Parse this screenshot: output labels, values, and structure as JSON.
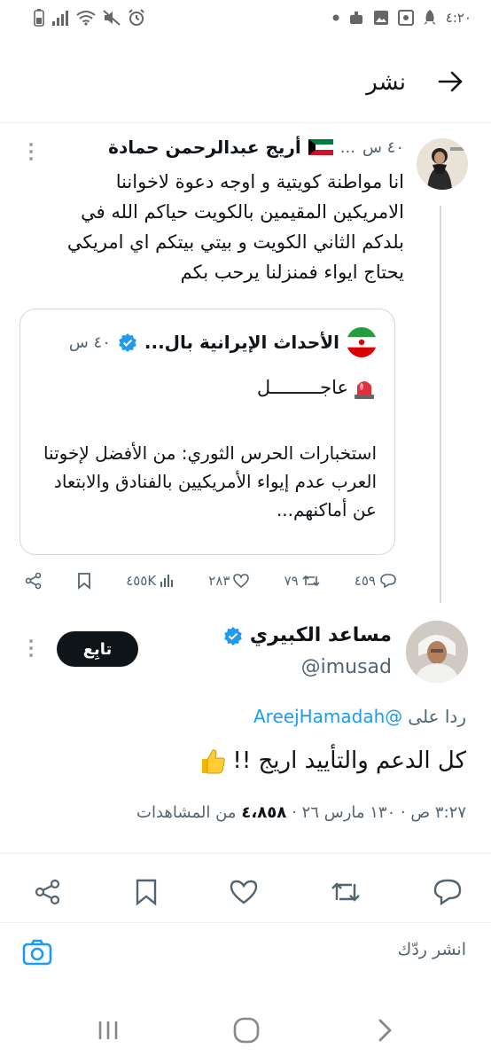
{
  "status_bar": {
    "time": "٤:٢٠",
    "left_icons": [
      "battery-icon",
      "signal-icon",
      "wifi-icon",
      "mute-icon",
      "alarm-icon"
    ],
    "right_icons": [
      "dot-icon",
      "robot-icon",
      "gallery-icon",
      "photo-icon",
      "rocket-icon"
    ]
  },
  "header": {
    "title": "نشر"
  },
  "original_tweet": {
    "author_name": "أريج عبدالرحمن حمادة",
    "ellipsis": "...",
    "time": "٤٠ س",
    "text": "انا مواطنة كويتية و اوجه دعوة لاخواننا الامريكين المقيمين بالكويت حياكم الله في بلدكم الثاني الكويت و بيتي بيتكم اي امريكي يحتاج ايواء فمنزلنا يرحب بكم",
    "quote": {
      "author_name": "الأحداث الإيرانية بال...",
      "time": "٤٠ س",
      "urgent_label": "عاجـــــــــل",
      "text": "استخبارات الحرس الثوري: من الأفضل لإخوتنا العرب عدم إيواء الأمريكيين بالفنادق والابتعاد عن أماكنهم..."
    },
    "actions": {
      "replies": "٤٥٩",
      "reposts": "٧٩",
      "likes": "٢٨٣",
      "views": "٤٥٥K"
    }
  },
  "reply_tweet": {
    "author_name": "مساعد الكبيري",
    "handle": "@imusad",
    "follow_label": "تابِع",
    "reply_to_prefix": "ردا على",
    "reply_to_handle": "@AreejHamadah",
    "text": "كل الدعم والتأييد اريج !!",
    "timestamp": "٣:٢٧ ص · ١٣٠ مارس ٢٦ ·",
    "views_count": "٤،٨٥٨",
    "views_label": "من المشاهدات"
  },
  "composer": {
    "placeholder": "انشر ردّك"
  },
  "colors": {
    "accent": "#1d9bf0",
    "text": "#0f1419",
    "muted": "#536471",
    "border": "#cfd9de"
  }
}
